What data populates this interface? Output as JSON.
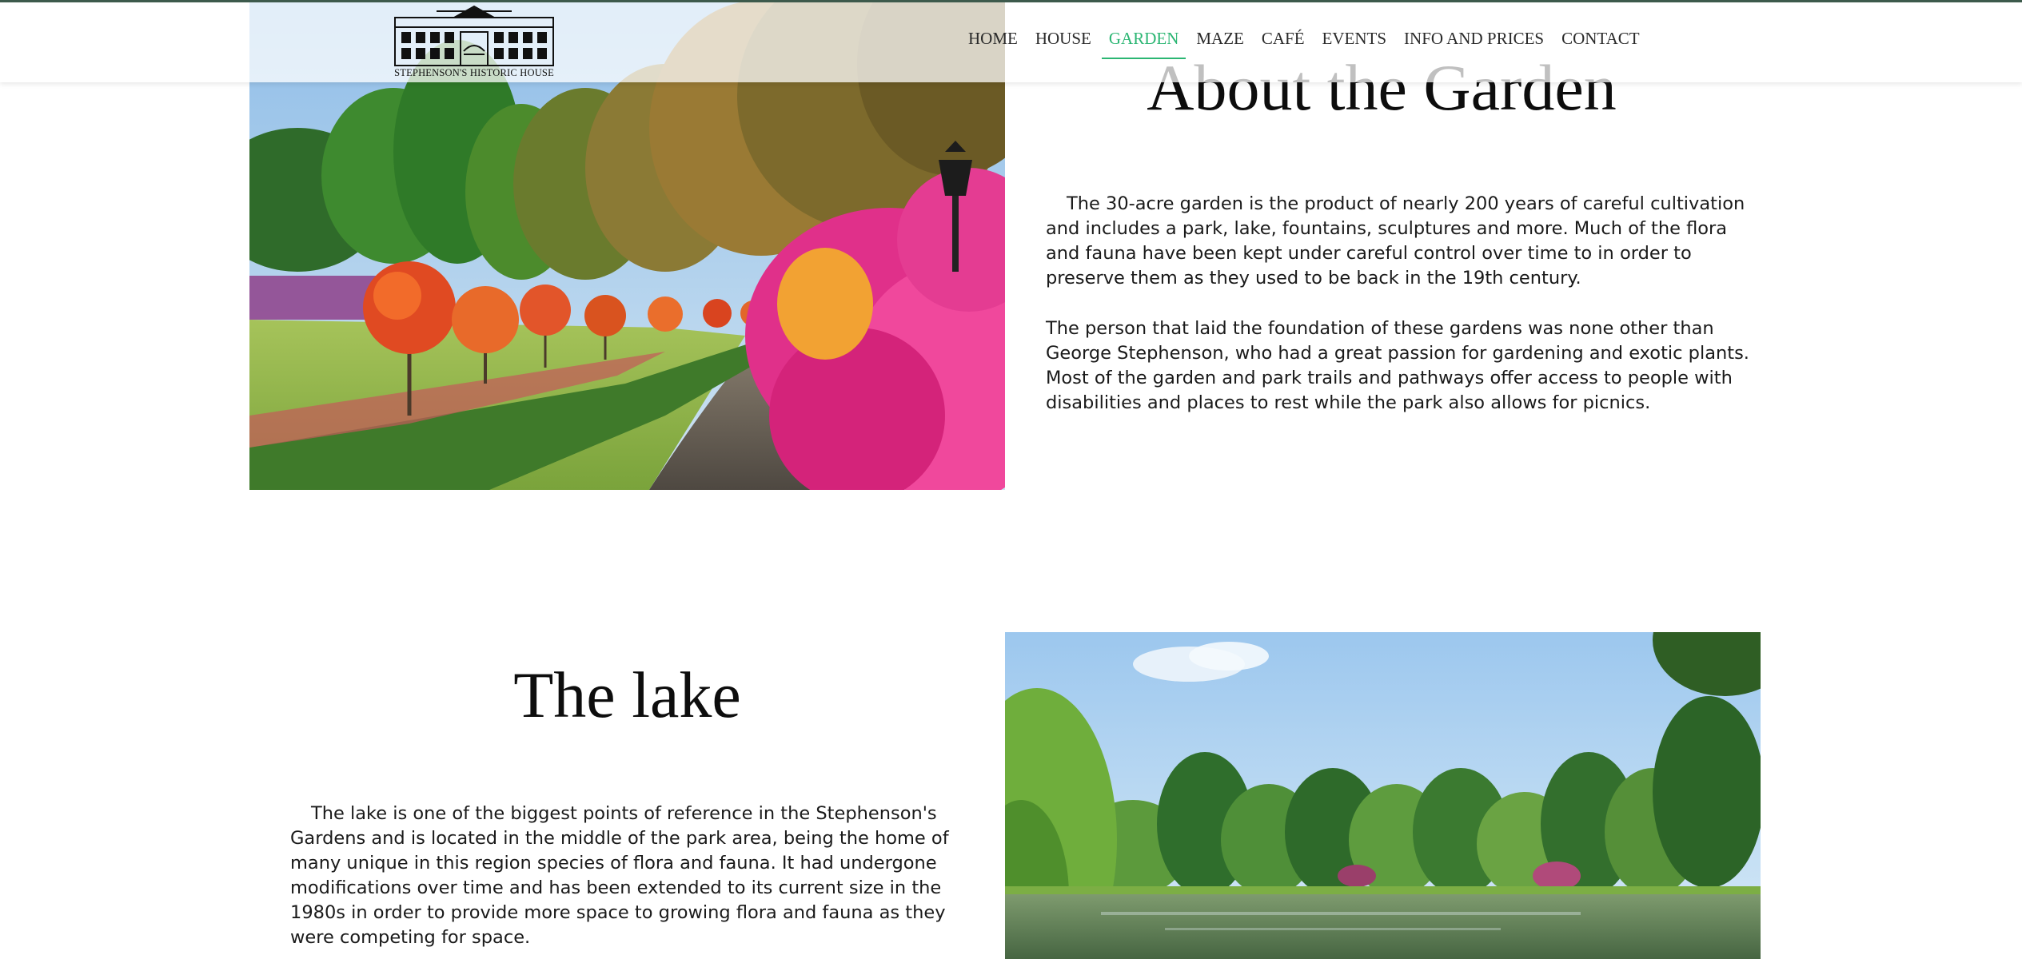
{
  "site": {
    "logo_text": "STEPHENSON'S HISTORIC HOUSE",
    "accent_color": "#2bb673"
  },
  "nav": {
    "items": [
      {
        "label": "HOME",
        "active": false
      },
      {
        "label": "HOUSE",
        "active": false
      },
      {
        "label": "GARDEN",
        "active": true
      },
      {
        "label": "MAZE",
        "active": false
      },
      {
        "label": "CAFÉ",
        "active": false
      },
      {
        "label": "EVENTS",
        "active": false
      },
      {
        "label": "INFO AND PRICES",
        "active": false
      },
      {
        "label": "CONTACT",
        "active": false
      }
    ]
  },
  "garden": {
    "title": "About the Garden",
    "paragraphs": [
      "The 30-acre garden is the product of nearly 200 years of careful cultivation and includes a park, lake, fountains, sculptures and more. Much of the flora and fauna have been kept under careful control over time to in order to preserve them as they used to be back in the 19th century.",
      "The person that laid the foundation of these gardens was none other than George Stephenson, who had a great passion for gardening and exotic plants. Most of the garden and park trails and pathways offer access to people with disabilities and places to rest while the park also allows for picnics."
    ]
  },
  "lake": {
    "title": "The lake",
    "paragraphs": [
      "The lake is one of the biggest points of reference in the Stephenson's Gardens and is located in the middle of the park area, being the home of many unique in this region species of flora and fauna. It had undergone modifications over time and has been extended to its current size in the 1980s in order to provide more space to growing flora and fauna as they were competing for space."
    ]
  }
}
